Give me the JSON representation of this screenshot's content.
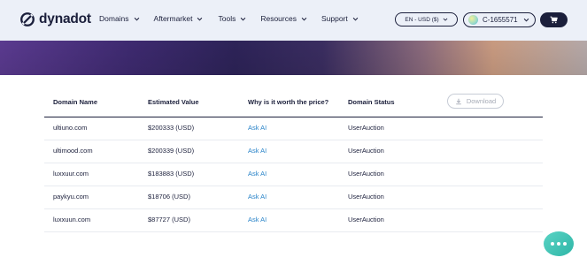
{
  "brand": {
    "name": "dynadot"
  },
  "nav": {
    "items": [
      {
        "label": "Domains"
      },
      {
        "label": "Aftermarket"
      },
      {
        "label": "Tools"
      },
      {
        "label": "Resources"
      },
      {
        "label": "Support"
      }
    ]
  },
  "header": {
    "language_label": "EN - USD ($)",
    "account_id": "C-1655571"
  },
  "table": {
    "columns": [
      "Domain Name",
      "Estimated Value",
      "Why is it worth the price?",
      "Domain Status"
    ],
    "download_label": "Download",
    "rows": [
      {
        "domain": "ultiuno.com",
        "value": "$200333 (USD)",
        "action": "Ask AI",
        "status": "UserAuction"
      },
      {
        "domain": "ultimood.com",
        "value": "$200339 (USD)",
        "action": "Ask AI",
        "status": "UserAuction"
      },
      {
        "domain": "luxxuur.com",
        "value": "$183883 (USD)",
        "action": "Ask AI",
        "status": "UserAuction"
      },
      {
        "domain": "paykyu.com",
        "value": "$18706 (USD)",
        "action": "Ask AI",
        "status": "UserAuction"
      },
      {
        "domain": "luxxuun.com",
        "value": "$87727 (USD)",
        "action": "Ask AI",
        "status": "UserAuction"
      }
    ]
  },
  "colors": {
    "brand_dark": "#1b1f3b",
    "link_blue": "#2a84c9",
    "chat_teal": "#2fb6a7"
  },
  "icons": [
    "logo-icon",
    "chevron-down-icon",
    "cart-icon",
    "download-icon",
    "chat-icon"
  ]
}
